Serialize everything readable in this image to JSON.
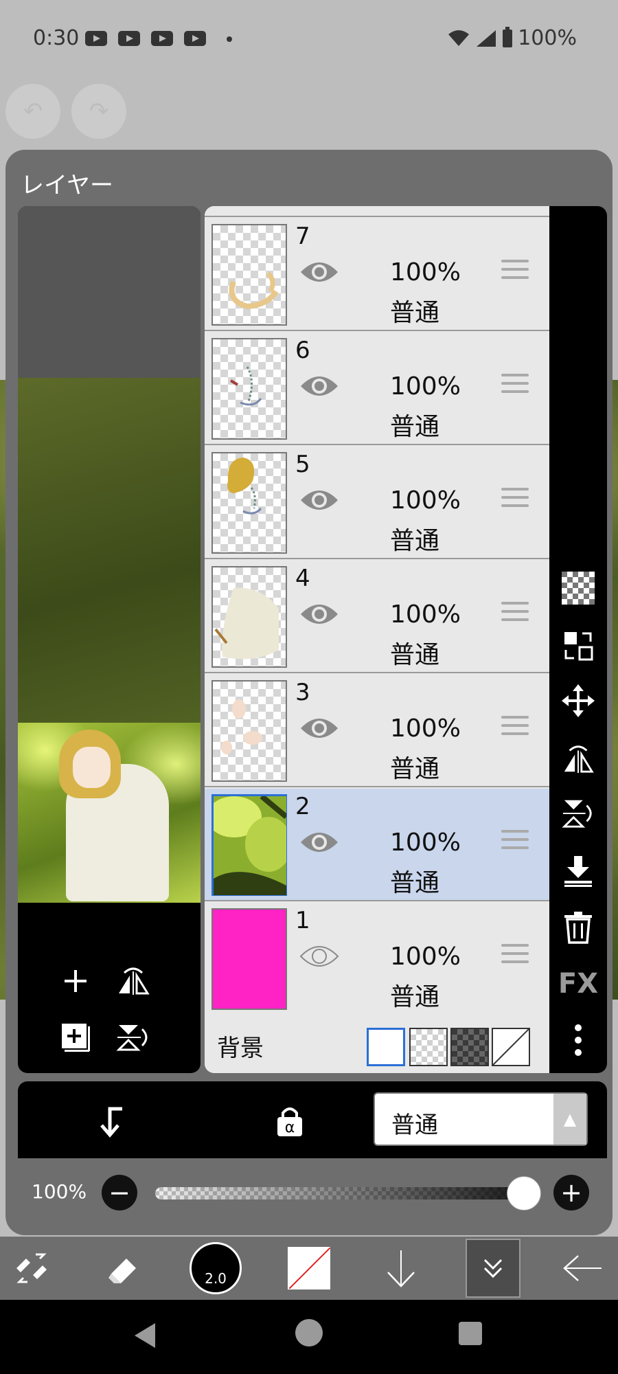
{
  "status_bar": {
    "time": "0:30",
    "battery": "100%"
  },
  "dialog": {
    "title": "レイヤー"
  },
  "layers": [
    {
      "number": "7",
      "opacity": "100%",
      "blend": "普通",
      "visible": true,
      "selected": false,
      "icon": "eye-icon"
    },
    {
      "number": "6",
      "opacity": "100%",
      "blend": "普通",
      "visible": true,
      "selected": false,
      "icon": "eye-icon"
    },
    {
      "number": "5",
      "opacity": "100%",
      "blend": "普通",
      "visible": true,
      "selected": false,
      "icon": "eye-icon"
    },
    {
      "number": "4",
      "opacity": "100%",
      "blend": "普通",
      "visible": true,
      "selected": false,
      "icon": "eye-icon"
    },
    {
      "number": "3",
      "opacity": "100%",
      "blend": "普通",
      "visible": true,
      "selected": false,
      "icon": "eye-icon"
    },
    {
      "number": "2",
      "opacity": "100%",
      "blend": "普通",
      "visible": true,
      "selected": true,
      "icon": "eye-icon"
    },
    {
      "number": "1",
      "opacity": "100%",
      "blend": "普通",
      "visible": false,
      "selected": false,
      "icon": "eye-outline-icon",
      "color": "#ff22c4"
    }
  ],
  "background": {
    "label": "背景",
    "options": [
      "white",
      "checker",
      "dark-checker",
      "none"
    ],
    "selected": "white"
  },
  "tool_column": {
    "fx_label": "FX",
    "icons": [
      "transparency-icon",
      "swap-layers-icon",
      "move-icon",
      "flip-horizontal-icon",
      "flip-vertical-icon",
      "merge-down-icon",
      "trash-icon",
      "fx-icon",
      "more-icon"
    ]
  },
  "action_bar": {
    "blend_mode": "普通"
  },
  "opacity_bar": {
    "value_label": "100%",
    "value": 1.0
  },
  "main_toolbar": {
    "brush_size": "2.0"
  },
  "colors": {
    "accent": "#2b6fd6",
    "selected_row": "#c9d6ec",
    "layer1_fill": "#ff22c4"
  }
}
